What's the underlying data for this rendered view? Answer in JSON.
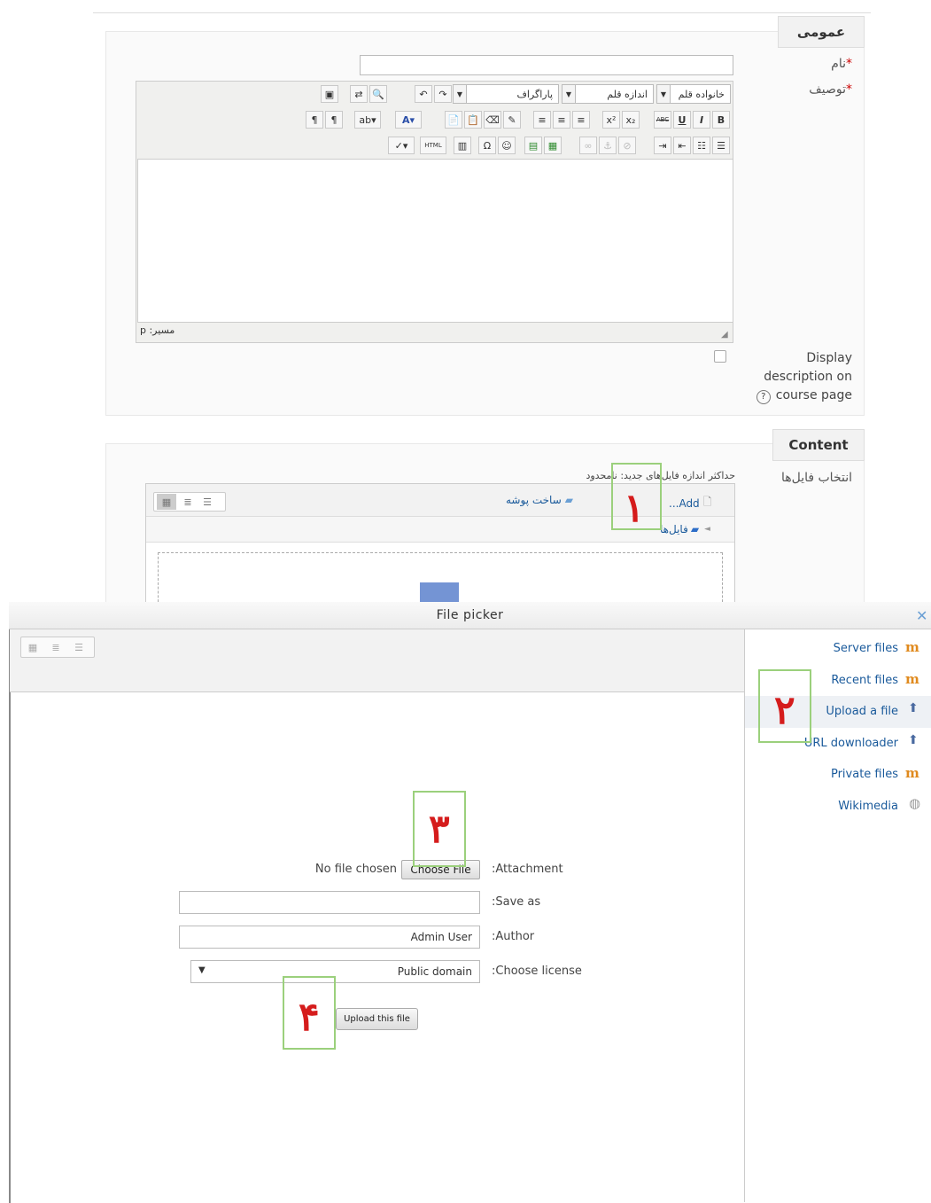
{
  "general": {
    "legend": "عمومی",
    "name_label": "نام",
    "description_label": "توصیف",
    "required_mark": "*",
    "editor": {
      "font_family": "خانواده قلم",
      "font_size": "اندازه قلم",
      "paragraph": "پاراگراف",
      "path_label": "مسیر: p",
      "html_label": "HTML"
    },
    "display_description_label_line1": "Display",
    "display_description_label_line2": "description on",
    "display_description_label_line3": "course page"
  },
  "content": {
    "legend": "Content",
    "select_files_label": "انتخاب فایل‌ها",
    "max_size_text": "حداکثر اندازه فایل‌های جدید: نامحدود",
    "add_label": "...Add",
    "create_folder_label": "ساخت پوشه",
    "files_breadcrumb": "فایل‌ها"
  },
  "file_picker": {
    "title": "File picker",
    "close": "✕",
    "repositories": [
      {
        "label": "Server files",
        "icon": "moodle-icon"
      },
      {
        "label": "Recent files",
        "icon": "moodle-icon"
      },
      {
        "label": "Upload a file",
        "icon": "upload-icon"
      },
      {
        "label": "URL downloader",
        "icon": "url-icon"
      },
      {
        "label": "Private files",
        "icon": "moodle-icon"
      },
      {
        "label": "Wikimedia",
        "icon": "wikimedia-icon"
      }
    ],
    "attachment_label": ":Attachment",
    "choose_file_button": "Choose File",
    "no_file_text": "No file chosen",
    "save_as_label": ":Save as",
    "save_as_value": "",
    "author_label": ":Author",
    "author_value": "Admin User",
    "license_label": ":Choose license",
    "license_value": "Public domain",
    "upload_button": "Upload this file"
  },
  "annotations": {
    "step1": "۱",
    "step2": "۲",
    "step3": "۳",
    "step4": "۴"
  },
  "colors": {
    "annotation_red": "#d51c1c",
    "annotation_green": "#9bd07c",
    "link_blue": "#1a5a9b"
  }
}
